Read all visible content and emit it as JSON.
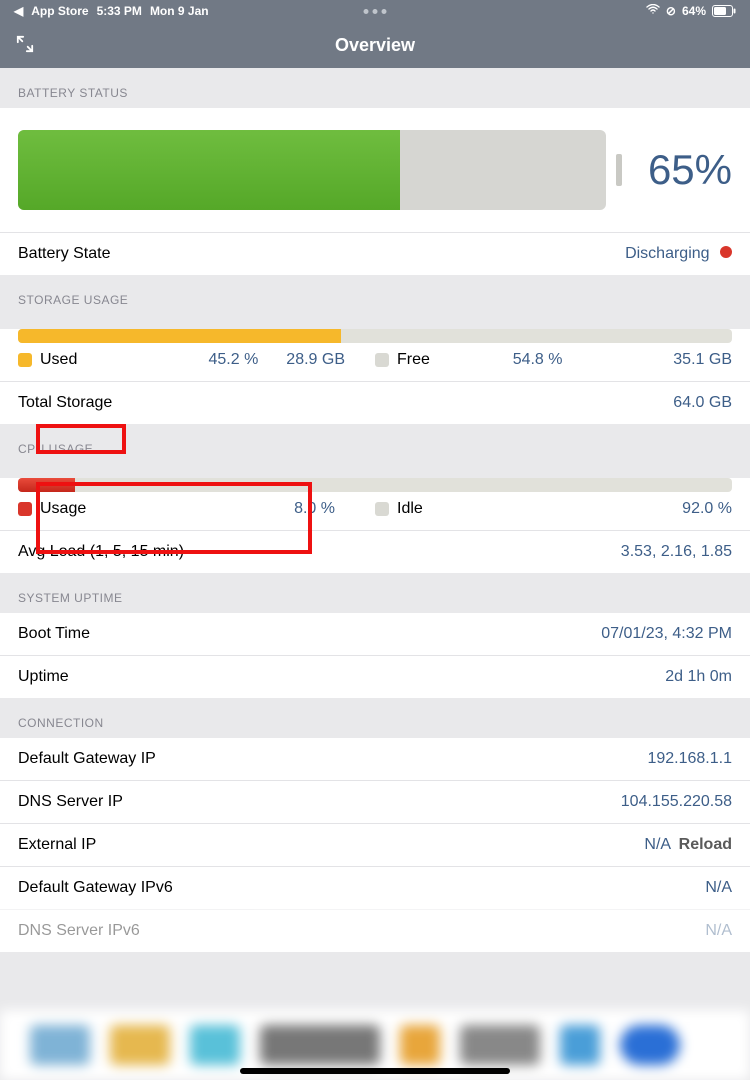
{
  "status_bar": {
    "back_app": "App Store",
    "time": "5:33 PM",
    "date": "Mon 9 Jan",
    "battery_pct": "64%"
  },
  "header": {
    "title": "Overview"
  },
  "battery": {
    "section": "Battery Status",
    "percent_text": "65%",
    "fill_pct": 65,
    "state_label": "Battery State",
    "state_value": "Discharging"
  },
  "storage": {
    "section": "Storage Usage",
    "used_label": "Used",
    "used_pct": "45.2 %",
    "used_gb": "28.9 GB",
    "free_label": "Free",
    "free_pct": "54.8 %",
    "free_gb": "35.1 GB",
    "total_label": "Total Storage",
    "total_value": "64.0 GB",
    "fill_pct": 45.2,
    "used_color": "#f6b82b",
    "free_color": "#d9d9d3"
  },
  "cpu": {
    "section": "CPU Usage",
    "usage_label": "Usage",
    "usage_pct_text": "8.0 %",
    "idle_label": "Idle",
    "idle_pct_text": "92.0 %",
    "avg_label": "Avg Load (1, 5, 15 min)",
    "avg_value": "3.53, 2.16, 1.85",
    "fill_pct": 8,
    "usage_color": "#d9362b",
    "idle_color": "#d9d9d3"
  },
  "uptime": {
    "section": "System Uptime",
    "boot_label": "Boot Time",
    "boot_value": "07/01/23, 4:32 PM",
    "uptime_label": "Uptime",
    "uptime_value": "2d 1h 0m"
  },
  "connection": {
    "section": "Connection",
    "rows": {
      "gateway_label": "Default Gateway IP",
      "gateway_value": "192.168.1.1",
      "dns_label": "DNS Server IP",
      "dns_value": "104.155.220.58",
      "ext_label": "External IP",
      "ext_value": "N/A",
      "ext_action": "Reload",
      "gateway6_label": "Default Gateway IPv6",
      "gateway6_value": "N/A",
      "dns6_label": "DNS Server IPv6",
      "dns6_value": "N/A"
    }
  }
}
